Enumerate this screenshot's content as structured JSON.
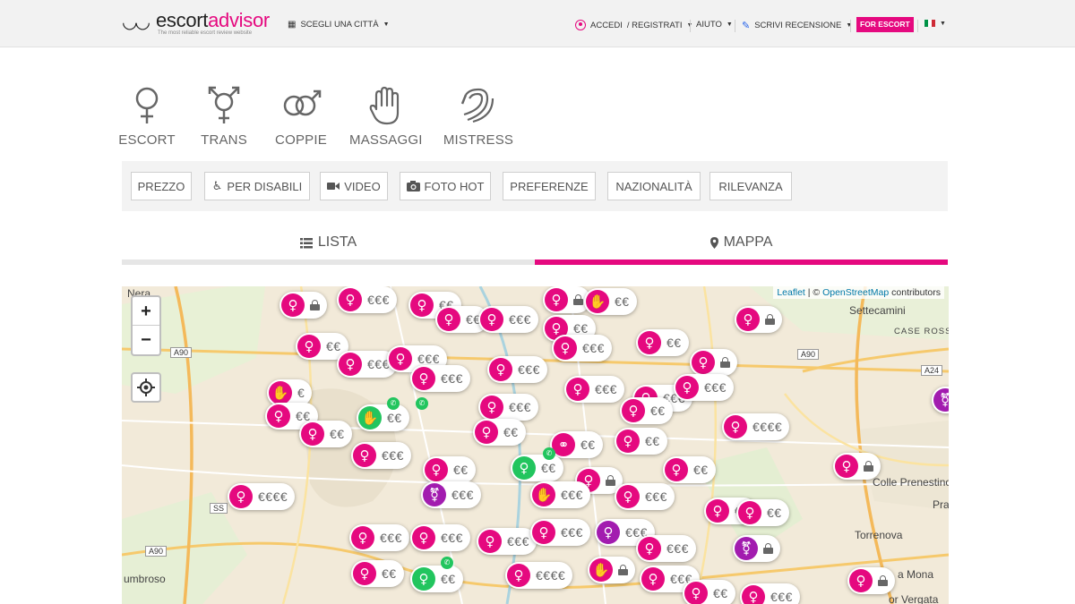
{
  "header": {
    "logo_text_a": "escort",
    "logo_text_b": "advisor",
    "logo_tagline": "The most reliable escort review website",
    "city_select": "SCEGLI UNA CITTÀ",
    "login": "ACCEDI",
    "register": "/ REGISTRATI",
    "help": "AIUTO",
    "write_review": "SCRIVI RECENSIONE",
    "for_escort": "FOR ESCORT",
    "colors": {
      "brand": "#e5097f"
    }
  },
  "categories": [
    {
      "label": "ESCORT",
      "icon": "female-icon"
    },
    {
      "label": "TRANS",
      "icon": "trans-icon"
    },
    {
      "label": "COPPIE",
      "icon": "couple-icon"
    },
    {
      "label": "MASSAGGI",
      "icon": "hand-icon"
    },
    {
      "label": "MISTRESS",
      "icon": "whip-icon"
    }
  ],
  "filters": [
    {
      "label": "PREZZO"
    },
    {
      "label": "PER DISABILI",
      "icon": "wheelchair-icon"
    },
    {
      "label": "VIDEO",
      "icon": "video-icon"
    },
    {
      "label": "FOTO HOT",
      "icon": "camera-icon"
    },
    {
      "label": "PREFERENZE"
    },
    {
      "label": "NAZIONALITÀ"
    },
    {
      "label": "RILEVANZA"
    }
  ],
  "tabs": {
    "list": "LISTA",
    "map": "MAPPA",
    "active": "MAPPA"
  },
  "map": {
    "zoom_in": "+",
    "zoom_out": "−",
    "attribution_leaflet": "Leaflet",
    "attribution_sep": " | © ",
    "attribution_osm": "OpenStreetMap",
    "attribution_tail": " contributors",
    "places": [
      "Nera",
      "Settecamini",
      "CASE ROSS",
      "Colle Prenestino",
      "Pra",
      "Torrenova",
      "umbroso",
      "a Mona",
      "or Vergata"
    ],
    "roads": [
      "A90",
      "A90",
      "A24",
      "SS",
      "A90"
    ]
  }
}
